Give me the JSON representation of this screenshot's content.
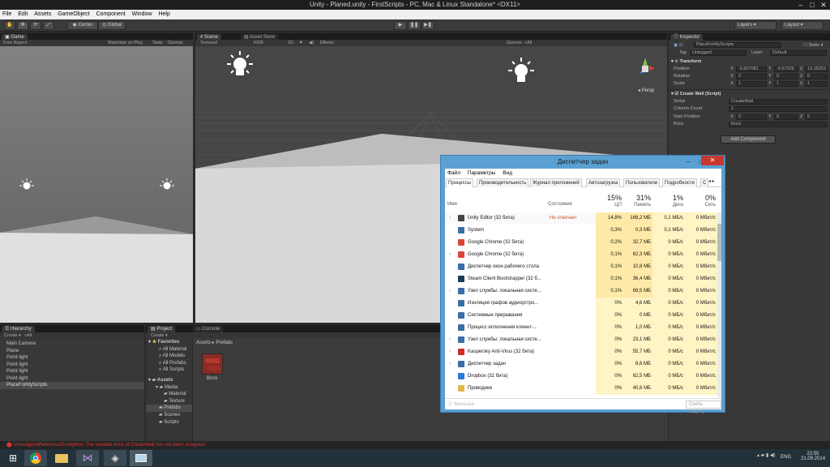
{
  "window": {
    "title": "Unity - Planed.unity - FirstScripts - PC, Mac & Linux Standalone* <DX11>"
  },
  "menu": [
    "File",
    "Edit",
    "Assets",
    "GameObject",
    "Component",
    "Window",
    "Help"
  ],
  "toolbar": {
    "center": "Center",
    "global": "Global",
    "layers": "Layers",
    "layout": "Layout"
  },
  "game": {
    "tab": "Game",
    "aspect": "Free Aspect",
    "maximize": "Maximize on Play",
    "stats": "Stats",
    "gizmos": "Gizmos"
  },
  "scene": {
    "tab": "Scene",
    "asset_store": "Asset Store",
    "render": "Textured",
    "rgb": "RGB",
    "twod": "2D",
    "effects": "Effects",
    "gizmos": "Gizmos",
    "search": "All",
    "persp": "Persp"
  },
  "inspector": {
    "tab": "Inspector",
    "object_name": "PlaceForMyScripts",
    "static": "Static",
    "tag_label": "Tag",
    "tag": "Untagged",
    "layer_label": "Layer",
    "layer": "Default",
    "transform": "Transform",
    "position": "Position",
    "rotation": "Rotation",
    "scale": "Scale",
    "pos": [
      "-5.667081",
      "-5.67026",
      "13.35263"
    ],
    "rot": [
      "0",
      "0",
      "0"
    ],
    "scl": [
      "1",
      "1",
      "1"
    ],
    "script_comp": "Create Wall (Script)",
    "script_label": "Script",
    "script_value": "CreateWall",
    "column_count_label": "Column Count",
    "column_count": "1",
    "start_position_label": "Start Position",
    "start_pos": [
      "0",
      "0",
      "0"
    ],
    "brick_label": "Brick",
    "brick_value": "Brick",
    "add_component": "Add Component",
    "x": "X",
    "y": "Y",
    "z": "Z"
  },
  "hierarchy": {
    "tab": "Hierarchy",
    "create": "Create",
    "search": "All",
    "items": [
      "Main Camera",
      "Plane",
      "Point light",
      "Point light",
      "Point light",
      "Point light",
      "PlaceForMyScripts"
    ]
  },
  "project": {
    "tab": "Project",
    "console_tab": "Console",
    "create": "Create",
    "favorites": "Favorites",
    "fav_items": [
      "All Material",
      "All Models",
      "All Prefabs",
      "All Scripts"
    ],
    "assets": "Assets",
    "asset_tree": [
      "Media",
      "Material",
      "Texture",
      "Prefabs",
      "Scenes",
      "Scripts"
    ],
    "breadcrumb": "Assets ▸ Prefabs",
    "brick": "Brick"
  },
  "status_message": "UnassignedReferenceException: The variable brick of CreateWall has not been assigned.",
  "taskbar": {
    "lang": "ENG",
    "time": "22:55",
    "date": "21.09.2014"
  },
  "taskmanager": {
    "title": "Диспетчер задач",
    "menu": [
      "Файл",
      "Параметры",
      "Вид"
    ],
    "tabs": [
      "Процессы",
      "Производительность",
      "Журнал приложений",
      "Автозагрузка",
      "Пользователи",
      "Подробности",
      "С"
    ],
    "col_name": "Имя",
    "col_state": "Состояние",
    "cpu_pct": "15%",
    "cpu_label": "ЦП",
    "mem_pct": "31%",
    "mem_label": "Память",
    "disk_pct": "1%",
    "disk_label": "Диск",
    "net_pct": "0%",
    "net_label": "Сеть",
    "rows": [
      {
        "name": "Unity Editor (32 бита)",
        "state": "Не отвечает",
        "cpu": "14,8%",
        "mem": "168,2 МБ",
        "disk": "0,1 МБ/с",
        "net": "0 Мбит/с",
        "expand": true,
        "icon": "#444"
      },
      {
        "name": "System",
        "state": "",
        "cpu": "0,3%",
        "mem": "0,3 МБ",
        "disk": "0,1 МБ/с",
        "net": "0 Мбит/с",
        "expand": false,
        "icon": "#3a6ea5"
      },
      {
        "name": "Google Chrome (32 бита)",
        "state": "",
        "cpu": "0,2%",
        "mem": "32,7 МБ",
        "disk": "0 МБ/с",
        "net": "0 Мбит/с",
        "expand": false,
        "icon": "#d9473a"
      },
      {
        "name": "Google Chrome (32 бита)",
        "state": "",
        "cpu": "0,1%",
        "mem": "62,3 МБ",
        "disk": "0 МБ/с",
        "net": "0 Мбит/с",
        "expand": true,
        "icon": "#d9473a"
      },
      {
        "name": "Диспетчер окон рабочего стола",
        "state": "",
        "cpu": "0,1%",
        "mem": "10,8 МБ",
        "disk": "0 МБ/с",
        "net": "0 Мбит/с",
        "expand": false,
        "icon": "#3a6ea5"
      },
      {
        "name": "Steam Client Bootstrapper (32 б...",
        "state": "",
        "cpu": "0,1%",
        "mem": "36,4 МБ",
        "disk": "0 МБ/с",
        "net": "0 Мбит/с",
        "expand": false,
        "icon": "#1b3b5a"
      },
      {
        "name": "Узел службы: локальная систе...",
        "state": "",
        "cpu": "0,1%",
        "mem": "69,5 МБ",
        "disk": "0 МБ/с",
        "net": "0 Мбит/с",
        "expand": true,
        "icon": "#3a6ea5"
      },
      {
        "name": "Изоляция графов аудиоустро...",
        "state": "",
        "cpu": "0%",
        "mem": "4,6 МБ",
        "disk": "0 МБ/с",
        "net": "0 Мбит/с",
        "expand": false,
        "icon": "#3a6ea5"
      },
      {
        "name": "Системные прерывания",
        "state": "",
        "cpu": "0%",
        "mem": "0 МБ",
        "disk": "0 МБ/с",
        "net": "0 Мбит/с",
        "expand": false,
        "icon": "#3a6ea5"
      },
      {
        "name": "Процесс исполнения клиент-...",
        "state": "",
        "cpu": "0%",
        "mem": "1,0 МБ",
        "disk": "0 МБ/с",
        "net": "0 Мбит/с",
        "expand": false,
        "icon": "#3a6ea5"
      },
      {
        "name": "Узел службы: локальная систе...",
        "state": "",
        "cpu": "0%",
        "mem": "23,1 МБ",
        "disk": "0 МБ/с",
        "net": "0 Мбит/с",
        "expand": true,
        "icon": "#3a6ea5"
      },
      {
        "name": "Kaspersky Anti-Virus (32 бита)",
        "state": "",
        "cpu": "0%",
        "mem": "55,7 МБ",
        "disk": "0 МБ/с",
        "net": "0 Мбит/с",
        "expand": true,
        "icon": "#d02b2b"
      },
      {
        "name": "Диспетчер задач",
        "state": "",
        "cpu": "0%",
        "mem": "8,6 МБ",
        "disk": "0 МБ/с",
        "net": "0 Мбит/с",
        "expand": true,
        "icon": "#3a6ea5"
      },
      {
        "name": "Dropbox (32 бита)",
        "state": "",
        "cpu": "0%",
        "mem": "62,5 МБ",
        "disk": "0 МБ/с",
        "net": "0 Мбит/с",
        "expand": false,
        "icon": "#2a7ad6"
      },
      {
        "name": "Проводник",
        "state": "",
        "cpu": "0%",
        "mem": "40,6 МБ",
        "disk": "0 МБ/с",
        "net": "0 Мбит/с",
        "expand": false,
        "icon": "#e3b64a"
      }
    ],
    "less": "Меньше",
    "end_task": "Снять задачу"
  }
}
